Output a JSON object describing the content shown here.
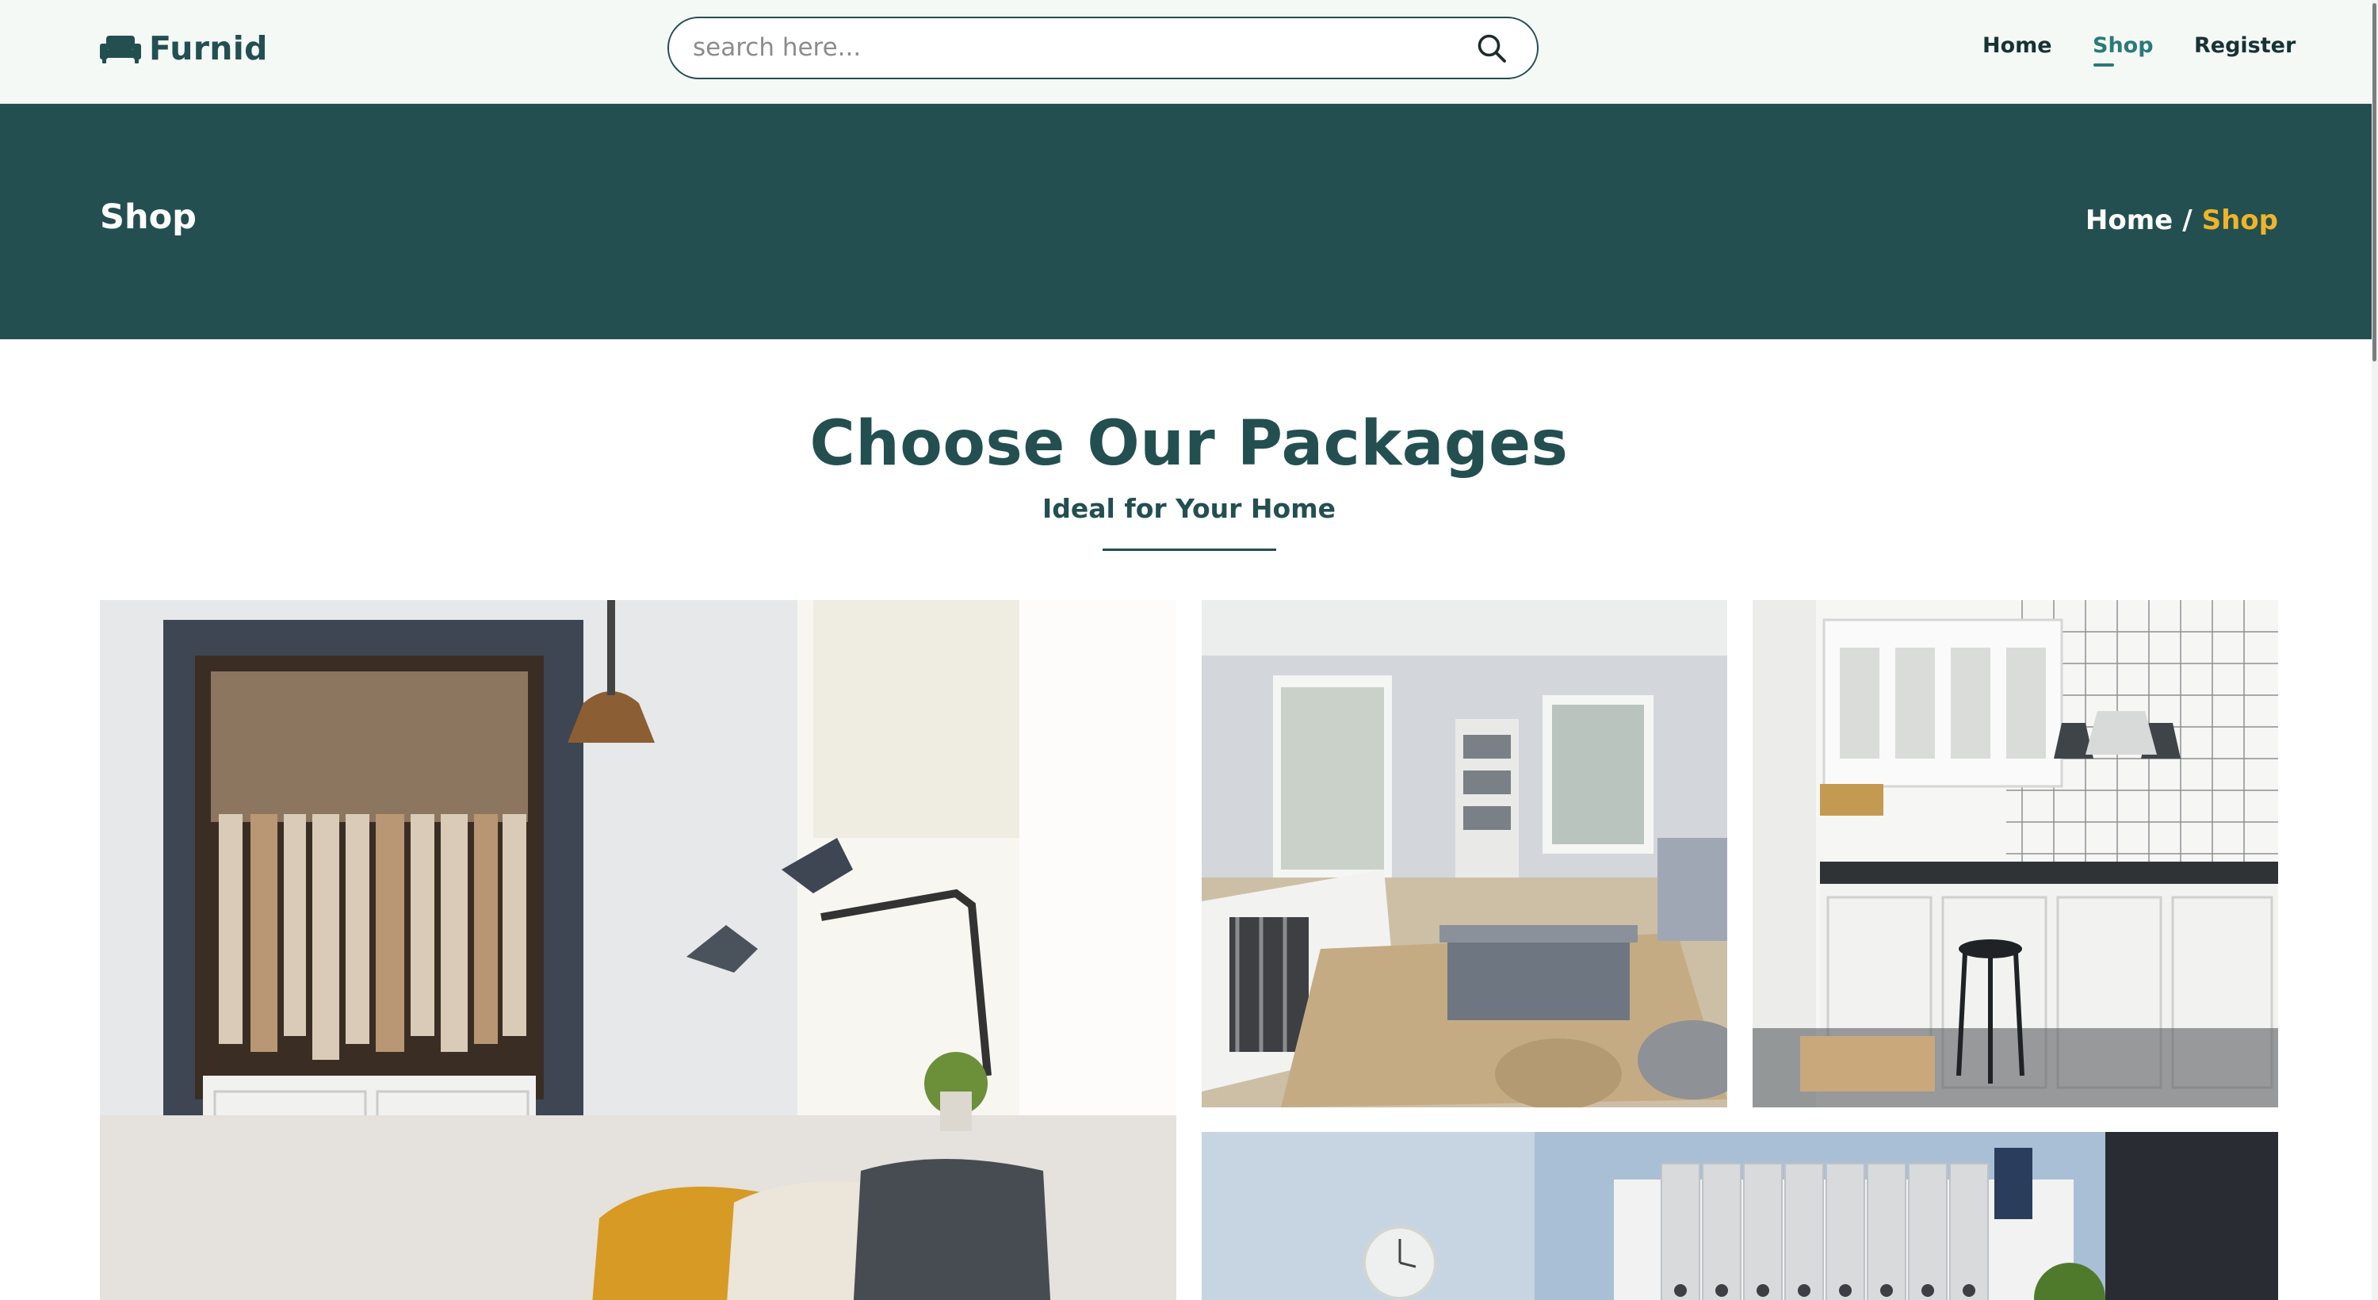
{
  "header": {
    "logo": {
      "icon": "sofa-icon",
      "text": "Furnid"
    },
    "search": {
      "placeholder": "search here...",
      "value": "",
      "icon": "search-icon"
    },
    "nav": [
      {
        "label": "Home",
        "active": false
      },
      {
        "label": "Shop",
        "active": true
      },
      {
        "label": "Register",
        "active": false
      }
    ]
  },
  "banner": {
    "title": "Shop",
    "breadcrumb": {
      "home": "Home",
      "separator": "/",
      "current": "Shop"
    }
  },
  "section": {
    "title": "Choose Our Packages",
    "subtitle": "Ideal for Your Home"
  },
  "gallery": [
    {
      "name": "bedroom-package-image"
    },
    {
      "name": "living-room-package-image"
    },
    {
      "name": "kitchen-package-image"
    },
    {
      "name": "home-office-package-image"
    }
  ],
  "colors": {
    "brand": "#234f51",
    "accent": "#f0b429",
    "active_nav": "#2a7a78",
    "header_bg": "#f5f9f6"
  }
}
